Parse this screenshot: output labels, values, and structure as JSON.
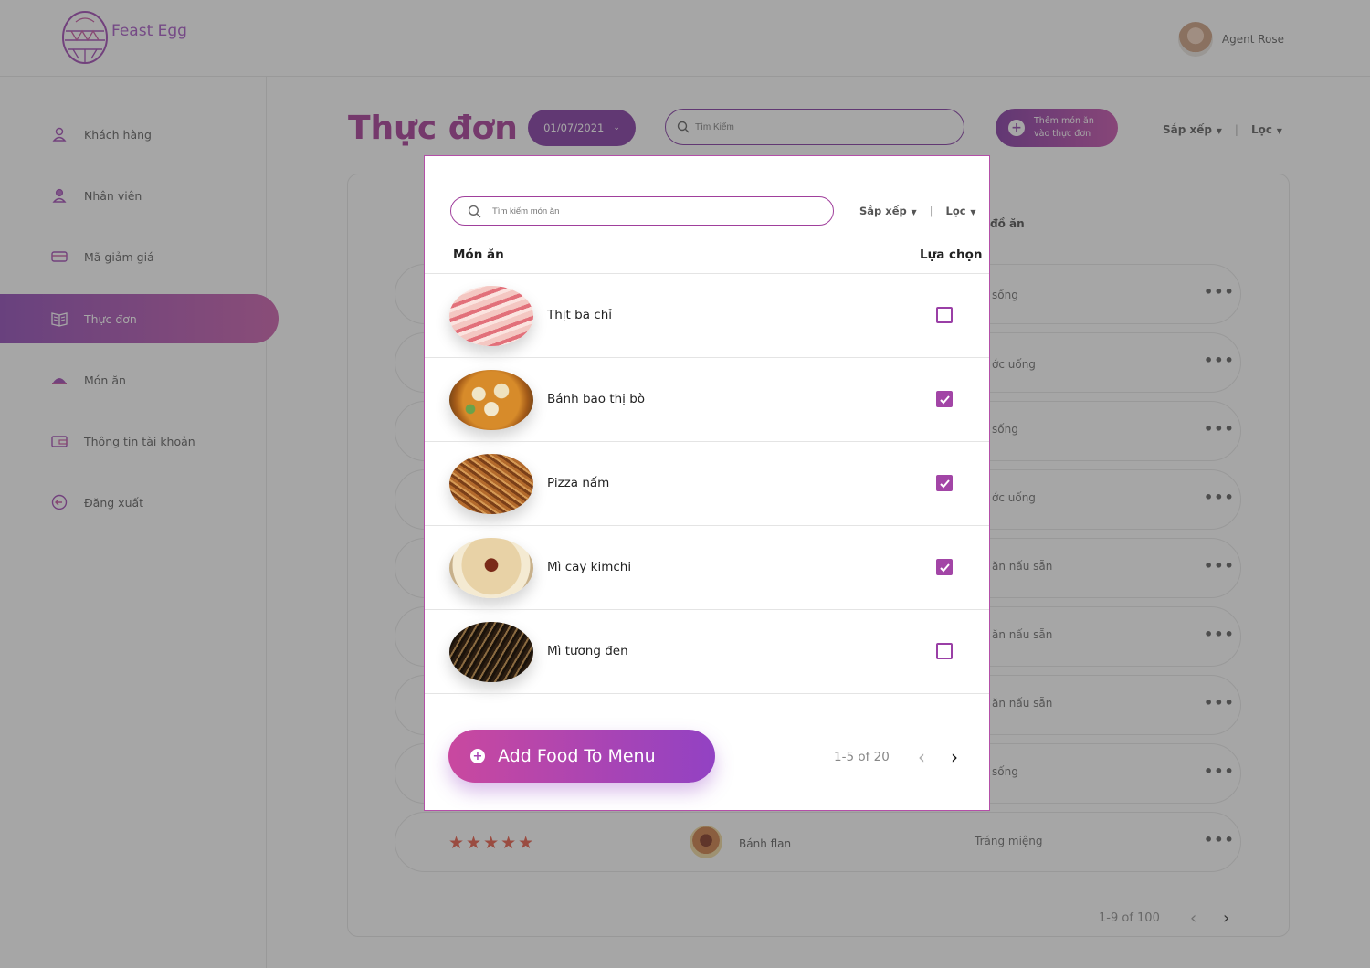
{
  "app": {
    "brand": "Feast Egg",
    "user_name": "Agent Rose"
  },
  "sidebar": {
    "items": [
      {
        "label": "Khách hàng",
        "icon": "user-icon",
        "active": false
      },
      {
        "label": "Nhân viên",
        "icon": "staff-icon",
        "active": false
      },
      {
        "label": "Mã giảm giá",
        "icon": "voucher-icon",
        "active": false
      },
      {
        "label": "Thực đơn",
        "icon": "menu-book-icon",
        "active": true
      },
      {
        "label": "Món ăn",
        "icon": "dish-icon",
        "active": false
      },
      {
        "label": "Thông tin tài khoản",
        "icon": "wallet-icon",
        "active": false
      },
      {
        "label": "Đăng xuất",
        "icon": "logout-icon",
        "active": false
      }
    ]
  },
  "main": {
    "title": "Thực đơn",
    "date": "01/07/2021",
    "search_placeholder": "Tìm Kiếm",
    "add_button_line1": "Thêm món ăn",
    "add_button_line2": "vào thực đơn",
    "sort_label": "Sắp xếp",
    "filter_label": "Lọc",
    "separator": "|",
    "column_partial": "đồ ăn",
    "row_types_partial": [
      "sống",
      "ớc uống",
      "sống",
      "ớc uống",
      "ăn nấu sẵn",
      "ăn nấu sẵn",
      "ăn nấu sẵn",
      "sống"
    ],
    "last_row": {
      "rating": "★★★★★",
      "name": "Bánh flan",
      "type": "Tráng miệng"
    },
    "row_menu": "•••",
    "pagination": "1-9 of 100",
    "prev": "‹",
    "next": "›"
  },
  "modal": {
    "search_placeholder": "Tìm kiếm món ăn",
    "sort_label": "Sắp xếp",
    "filter_label": "Lọc",
    "separator": "|",
    "col_food": "Món ăn",
    "col_select": "Lựa chọn",
    "items": [
      {
        "name": "Thịt ba chỉ",
        "checked": false
      },
      {
        "name": "Bánh bao thị bò",
        "checked": true
      },
      {
        "name": "Pizza nấm",
        "checked": true
      },
      {
        "name": "Mì cay kimchi",
        "checked": true
      },
      {
        "name": "Mì tương đen",
        "checked": false
      }
    ],
    "add_button": "Add Food To Menu",
    "pagination": "1-5 of 20",
    "prev": "‹",
    "next": "›"
  },
  "colors": {
    "brand_purple": "#7c2c9e",
    "accent_pink": "#c447a8",
    "star": "#e9533f"
  }
}
